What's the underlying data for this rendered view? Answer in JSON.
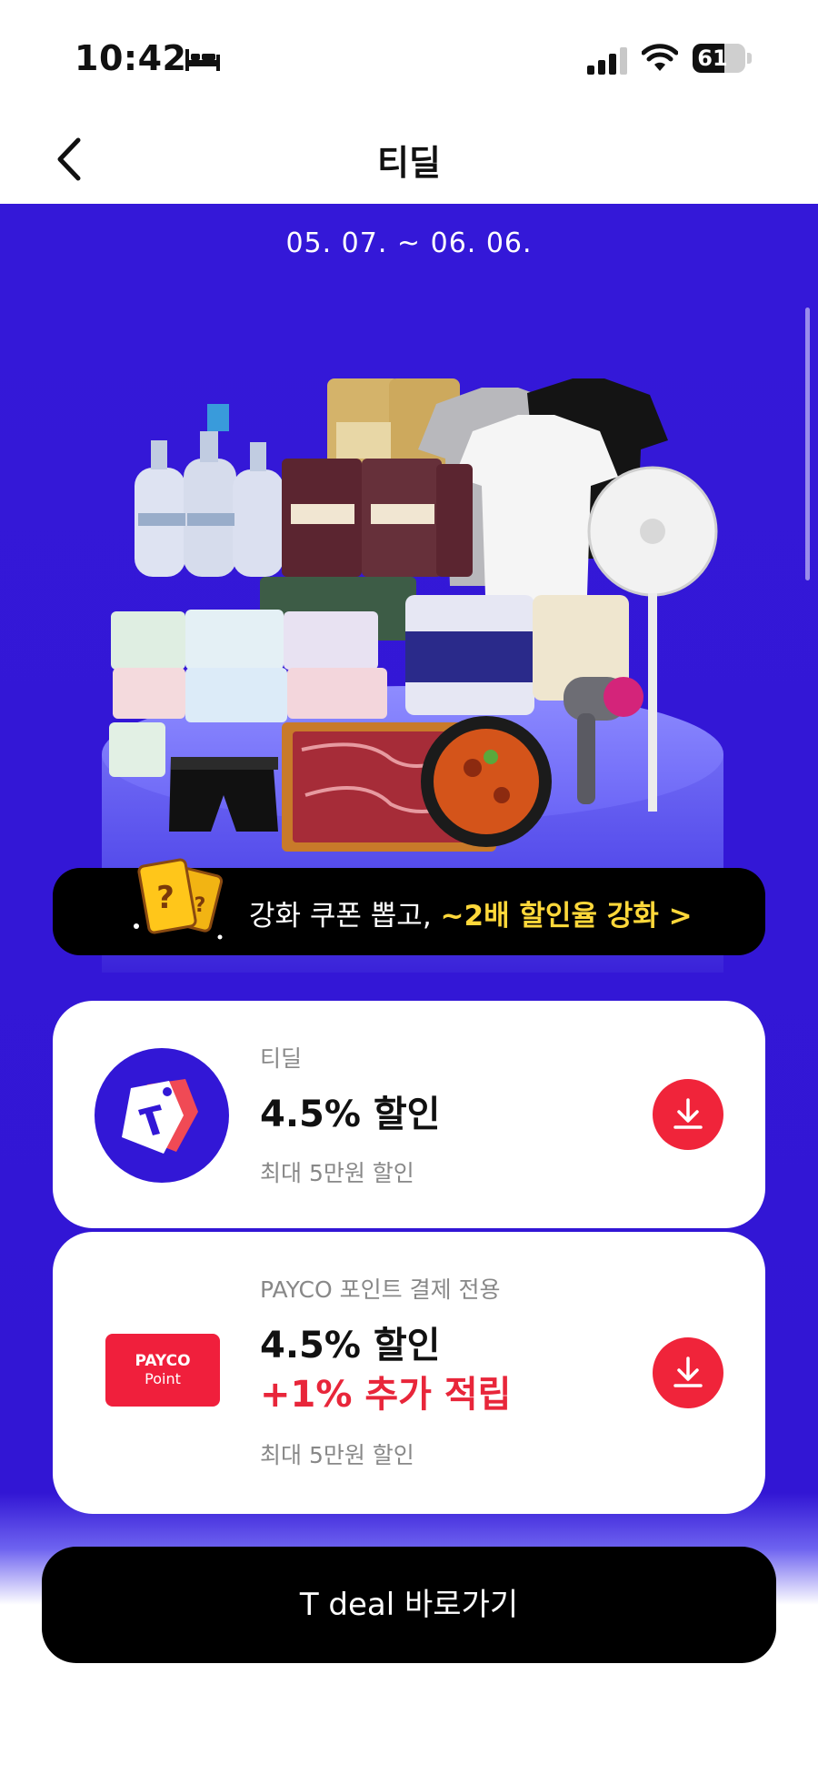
{
  "status_bar": {
    "time": "10:42",
    "battery": "61",
    "battery_level": 0.61,
    "icons": [
      "bed-icon",
      "cellular-signal-icon",
      "wifi-icon",
      "battery-icon"
    ]
  },
  "nav": {
    "title": "티딜",
    "back_icon": "chevron-left-icon"
  },
  "promo": {
    "period": "05. 07. ~ 06. 06.",
    "hero_image": "product-collage (water, baby formula, t-shirts, fan, diapers, toilet paper, rice, hair dryer, beef, stir-fried pork, underwear) on purple pedestal"
  },
  "roulette_banner": {
    "text": "강화 쿠폰 뽑고, ",
    "highlight": "~2배 할인율 강화 >",
    "icon": "mystery-card-icon"
  },
  "coupons": [
    {
      "label": "티딜",
      "discount": "4.5% 할인",
      "extra": "",
      "note": "최대 5만원 할인",
      "logo": "tdeal-tag-logo",
      "action_icon": "download-icon"
    },
    {
      "label": "PAYCO 포인트 결제 전용",
      "discount": "4.5% 할인",
      "extra": "+1% 추가 적립",
      "note": "최대 5만원 할인",
      "logo_line1": "PAYCO",
      "logo_line2": "Point",
      "action_icon": "download-icon"
    }
  ],
  "cta": {
    "label": "T deal 바로가기"
  },
  "colors": {
    "primary_purple": "#3418D8",
    "accent_red": "#F0243A",
    "highlight_yellow": "#FFD83A",
    "black": "#000000"
  }
}
